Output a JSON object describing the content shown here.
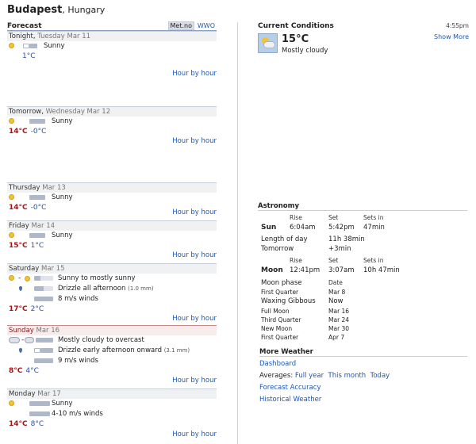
{
  "header": {
    "city": "Budapest",
    "country": "Hungary"
  },
  "forecast": {
    "title": "Forecast",
    "source_active": "Met.no",
    "source_other": "WWO",
    "hour_link": "Hour by hour",
    "days": [
      {
        "dow": "Tonight",
        "date": "Tuesday Mar 11",
        "conditions": [
          "Sunny"
        ],
        "hi": "",
        "lo": "1°C"
      },
      {
        "dow": "Tomorrow",
        "date": "Wednesday Mar 12",
        "conditions": [
          "Sunny"
        ],
        "hi": "14°C",
        "lo": "-0°C"
      },
      {
        "dow": "Thursday",
        "date": "Mar 13",
        "conditions": [
          "Sunny"
        ],
        "hi": "14°C",
        "lo": "-0°C"
      },
      {
        "dow": "Friday",
        "date": "Mar 14",
        "conditions": [
          "Sunny"
        ],
        "hi": "15°C",
        "lo": "1°C"
      },
      {
        "dow": "Saturday",
        "date": "Mar 15",
        "conditions": [
          "Sunny to mostly sunny",
          "Drizzle all afternoon",
          "8 m/s winds"
        ],
        "precip": "(1.0 mm)",
        "hi": "17°C",
        "lo": "2°C"
      },
      {
        "dow": "Sunday",
        "date": "Mar 16",
        "conditions": [
          "Mostly cloudy to overcast",
          "Drizzle early afternoon onward",
          "9 m/s winds"
        ],
        "precip": "(3.1 mm)",
        "hi": "8°C",
        "lo": "4°C"
      },
      {
        "dow": "Monday",
        "date": "Mar 17",
        "conditions": [
          "Sunny",
          "4-10 m/s winds"
        ],
        "hi": "14°C",
        "lo": "8°C"
      }
    ]
  },
  "current": {
    "title": "Current Conditions",
    "time": "4:55pm",
    "show_more": "Show More",
    "temp": "15°C",
    "desc": "Mostly cloudy"
  },
  "astronomy": {
    "title": "Astronomy",
    "rise_label": "Rise",
    "set_label": "Set",
    "sets_in_label": "Sets in",
    "sun": {
      "label": "Sun",
      "rise": "6:04am",
      "set": "5:42pm",
      "sets_in": "47min"
    },
    "length_label": "Length of day",
    "length": "11h 38min",
    "tomorrow_label": "Tomorrow",
    "tomorrow": "+3min",
    "moon": {
      "label": "Moon",
      "rise": "12:41pm",
      "set": "3:07am",
      "sets_in": "10h 47min"
    },
    "phase_label": "Moon phase",
    "date_label": "Date",
    "phases": [
      {
        "name": "First Quarter",
        "date": "Mar 8"
      },
      {
        "name": "Waxing Gibbous",
        "date": "Now"
      },
      {
        "name": "Full Moon",
        "date": "Mar 16"
      },
      {
        "name": "Third Quarter",
        "date": "Mar 24"
      },
      {
        "name": "New Moon",
        "date": "Mar 30"
      },
      {
        "name": "First Quarter",
        "date": "Apr 7"
      }
    ]
  },
  "more_weather": {
    "title": "More Weather",
    "dashboard": "Dashboard",
    "averages_label": "Averages:",
    "full_year": "Full year",
    "this_month": "This month",
    "today": "Today",
    "forecast_accuracy": "Forecast Accuracy",
    "historical": "Historical Weather"
  }
}
